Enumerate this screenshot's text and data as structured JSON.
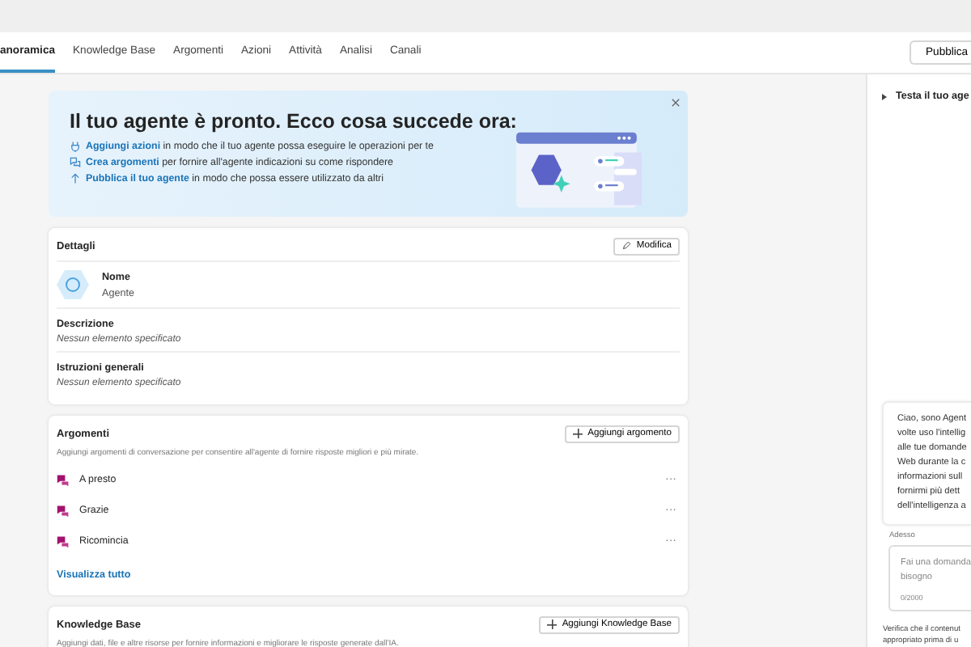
{
  "tabs": [
    {
      "label": "anoramica",
      "selected": true
    },
    {
      "label": "Knowledge Base",
      "selected": false
    },
    {
      "label": "Argomenti",
      "selected": false
    },
    {
      "label": "Azioni",
      "selected": false
    },
    {
      "label": "Attività",
      "selected": false
    },
    {
      "label": "Analisi",
      "selected": false
    },
    {
      "label": "Canali",
      "selected": false
    }
  ],
  "publish_button": "Pubblica",
  "banner": {
    "title": "Il tuo agente è pronto. Ecco cosa succede ora:",
    "steps": [
      {
        "kind": "actions",
        "link": "Aggiungi azioni",
        "text": " in modo che il tuo agente possa eseguire le operazioni per te"
      },
      {
        "kind": "topics",
        "link": "Crea argomenti",
        "text": " per fornire all'agente indicazioni su come rispondere"
      },
      {
        "kind": "publish",
        "link": "Pubblica il tuo agente",
        "text": " in modo che possa essere utilizzato da altri"
      }
    ]
  },
  "details": {
    "title": "Dettagli",
    "edit_button": "Modifica",
    "name_label": "Nome",
    "name_value": "Agente",
    "fields": [
      {
        "label": "Descrizione",
        "value": "Nessun elemento specificato"
      },
      {
        "label": "Istruzioni generali",
        "value": "Nessun elemento specificato"
      }
    ]
  },
  "topics": {
    "title": "Argomenti",
    "add_button": "Aggiungi argomento",
    "description": "Aggiungi argomenti di conversazione per consentire all'agente di fornire risposte migliori e più mirate.",
    "items": [
      {
        "label": "A presto",
        "more": "···"
      },
      {
        "label": "Grazie",
        "more": "···"
      },
      {
        "label": "Ricomincia",
        "more": "···"
      }
    ],
    "view_all": "Visualizza tutto"
  },
  "knowledge": {
    "title": "Knowledge Base",
    "add_button": "Aggiungi Knowledge Base",
    "description": "Aggiungi dati, file e altre risorse per fornire informazioni e migliorare le risposte generate dall'IA."
  },
  "test_panel": {
    "title": "Testa il tuo age",
    "message_lines": [
      "Ciao, sono Agent",
      "volte uso l'intellig",
      "alle tue domande",
      "Web durante la c",
      "informazioni sull",
      "fornirmi più dett",
      "dell'intelligenza a"
    ],
    "timestamp": "Adesso",
    "input_placeholder": "Fai una domanda",
    "input_placeholder_2": "bisogno",
    "char_count": "0/2000",
    "footer_lines": [
      "Verifica che il contenut",
      "appropriato prima di u"
    ]
  }
}
